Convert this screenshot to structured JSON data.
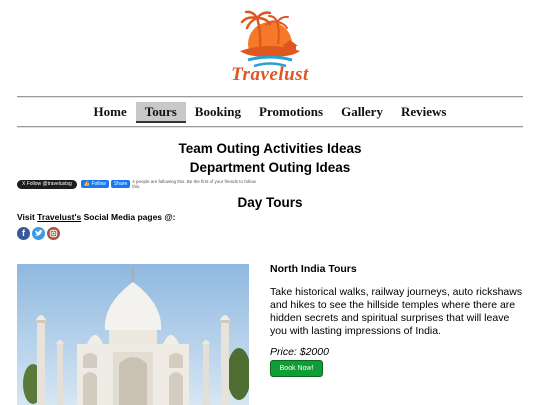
{
  "brand": {
    "name": "Travelust",
    "logo_icon": "palm-island-sunset-logo",
    "accent": "#e0561f"
  },
  "nav": {
    "items": [
      {
        "label": "Home",
        "active": false
      },
      {
        "label": "Tours",
        "active": true
      },
      {
        "label": "Booking",
        "active": false
      },
      {
        "label": "Promotions",
        "active": false
      },
      {
        "label": "Gallery",
        "active": false
      },
      {
        "label": "Reviews",
        "active": false
      }
    ]
  },
  "headings": {
    "team_outing": "Team Outing Activities Ideas",
    "department_outing": "Department Outing Ideas",
    "day_tours": "Day Tours"
  },
  "social_buttons": {
    "twitter_label": "X Follow @travelustsg",
    "fb_follow": "Follow",
    "fb_share": "Share",
    "fb_text": "4 people are following this. Be the first of your friends to follow this."
  },
  "social": {
    "visit_prefix": "Visit ",
    "visit_link": "Travelust's",
    "visit_suffix": " Social Media pages @:",
    "icons": [
      "facebook-icon",
      "twitter-icon",
      "instagram-icon"
    ]
  },
  "tour": {
    "image": "taj-mahal-photo",
    "title": "North India Tours",
    "description": "Take historical walks, railway journeys, auto rickshaws and hikes to see the hillside temples where there are hidden secrets and spiritual surprises that will leave you with lasting impressions of India.",
    "price": "Price: $2000",
    "book_label": "Book Now!"
  }
}
